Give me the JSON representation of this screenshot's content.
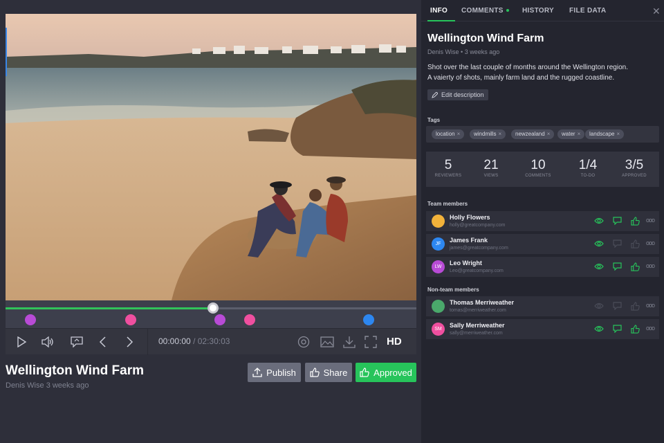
{
  "player": {
    "current_time": "00:00:00",
    "separator": "/",
    "total_time": "02:30:03",
    "quality": "HD",
    "progress_fraction": 0.505,
    "comment_markers": [
      {
        "color": "#b84bd6",
        "fraction": 0.06
      },
      {
        "color": "#ef4f9f",
        "fraction": 0.305
      },
      {
        "color": "#b84bd6",
        "fraction": 0.522
      },
      {
        "color": "#ef4f9f",
        "fraction": 0.595
      },
      {
        "color": "#2d87f0",
        "fraction": 0.884
      }
    ],
    "control_icons": [
      "play-icon",
      "volume-icon",
      "comment-icon",
      "prev-icon",
      "next-icon",
      "target-icon",
      "image-icon",
      "download-icon",
      "fullscreen-icon"
    ]
  },
  "asset": {
    "title": "Wellington Wind Farm",
    "author": "Denis Wise",
    "time_ago": "3 weeks ago"
  },
  "actions": {
    "publish_label": "Publish",
    "share_label": "Share",
    "approved_label": "Approved"
  },
  "colors": {
    "accent_green": "#27c45b",
    "panel_bg": "#24252f",
    "main_bg": "#2e2f3a"
  },
  "tabs": [
    {
      "label": "INFO",
      "active": true
    },
    {
      "label": "COMMENTS",
      "active": false
    },
    {
      "label": "HISTORY",
      "active": false
    },
    {
      "label": "FILE DATA",
      "active": false
    }
  ],
  "info": {
    "title": "Wellington Wind Farm",
    "author": "Denis Wise",
    "bullet": "•",
    "time_ago": "3 weeks ago",
    "description_line1": "Shot over the last couple of months around the Wellington region.",
    "description_line2": "A vaierty of shots, mainly farm land and the rugged coastline.",
    "edit_label": "Edit description",
    "tags_heading": "Tags",
    "tags": [
      "location",
      "windmills",
      "newzealand",
      "water",
      "landscape"
    ],
    "stats": [
      {
        "value": "5",
        "label": "REVIEWERS"
      },
      {
        "value": "21",
        "label": "VIEWS"
      },
      {
        "value": "10",
        "label": "COMMENTS"
      },
      {
        "value": "1/4",
        "label": "TO-DO"
      },
      {
        "value": "3/5",
        "label": "APPROVED"
      }
    ],
    "team_heading": "Team members",
    "team": [
      {
        "name": "Holly Flowers",
        "email": "holly@greatcompany.com",
        "initials": "",
        "avatar_color": "#f2b23a",
        "seen": true,
        "commented": true,
        "approved": true
      },
      {
        "name": "James Frank",
        "email": "james@greatcompany.com",
        "initials": "JF",
        "avatar_color": "#2d87f0",
        "seen": true,
        "commented": false,
        "approved": false
      },
      {
        "name": "Leo Wright",
        "email": "Leo@greatcompany.com",
        "initials": "LW",
        "avatar_color": "#b84bd6",
        "seen": true,
        "commented": true,
        "approved": true
      }
    ],
    "nonteam_heading": "Non-team members",
    "nonteam": [
      {
        "name": "Thomas Merriweather",
        "email": "tomas@merriweather.com",
        "initials": "",
        "avatar_color": "#4aa86b",
        "seen": false,
        "commented": false,
        "approved": false
      },
      {
        "name": "Sally Merriweather",
        "email": "sally@merriweather.com",
        "initials": "SM",
        "avatar_color": "#ef4f9f",
        "seen": true,
        "commented": true,
        "approved": true
      }
    ]
  }
}
